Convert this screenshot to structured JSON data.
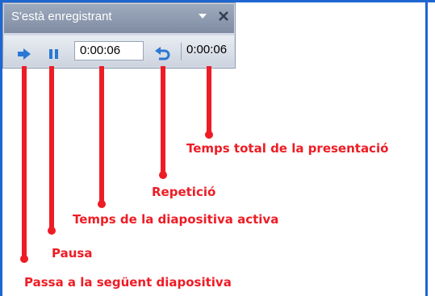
{
  "recording_toolbar": {
    "title": "S'està enregistrant",
    "slide_time": "0:00:06",
    "total_time": "0:00:06",
    "icons": {
      "dropdown": "chevron-down-icon",
      "close": "close-icon",
      "next": "arrow-right-icon",
      "pause": "pause-icon",
      "repeat": "undo-arrow-icon"
    }
  },
  "callouts": {
    "next": "Passa a la següent diapositiva",
    "pause": "Pausa",
    "slide_time": "Temps de la diapositiva activa",
    "repeat": "Repetició",
    "total_time": "Temps total de la presentació"
  },
  "colors": {
    "callout_red": "#ee1c25",
    "frame_blue": "#1f66d1",
    "icon_blue": "#2b78d4"
  }
}
